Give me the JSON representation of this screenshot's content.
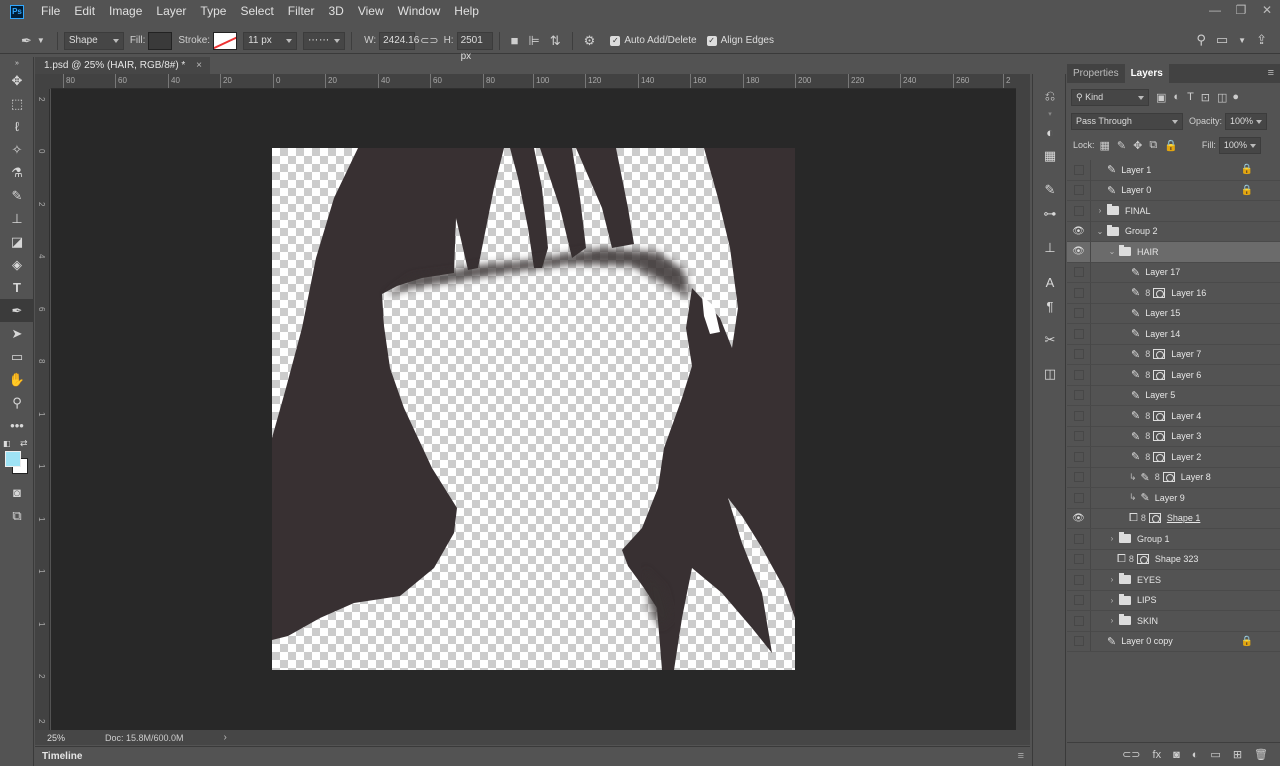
{
  "menu": {
    "logo": "Ps",
    "items": [
      "File",
      "Edit",
      "Image",
      "Layer",
      "Type",
      "Select",
      "Filter",
      "3D",
      "View",
      "Window",
      "Help"
    ],
    "window_controls": [
      "—",
      "❐",
      "✕"
    ]
  },
  "options": {
    "mode": "Shape",
    "fill_label": "Fill:",
    "stroke_label": "Stroke:",
    "stroke_width": "11 px",
    "w_label": "W:",
    "w_value": "2424.16",
    "h_label": "H:",
    "h_value": "2501 px",
    "auto_add_delete": "Auto Add/Delete",
    "align_edges": "Align Edges",
    "fill_color": "#3a3a3a"
  },
  "document": {
    "tab_title": "1.psd @ 25% (HAIR, RGB/8#) *",
    "zoom": "25%",
    "doc_info": "Doc: 15.8M/600.0M",
    "timeline": "Timeline"
  },
  "ruler": {
    "h_ticks": [
      "80",
      "60",
      "40",
      "20",
      "0",
      "20",
      "40",
      "60",
      "80",
      "100",
      "120",
      "140",
      "160",
      "180",
      "200",
      "220",
      "240",
      "260",
      "2"
    ],
    "v_ticks": [
      "2",
      "0",
      "2",
      "4",
      "6",
      "8",
      "1",
      "1",
      "1",
      "1",
      "1",
      "2",
      "2"
    ]
  },
  "panel": {
    "tab_properties": "Properties",
    "tab_layers": "Layers",
    "kind": "Kind",
    "blend_mode": "Pass Through",
    "opacity_label": "Opacity:",
    "opacity": "100%",
    "lock_label": "Lock:",
    "fill_label": "Fill:",
    "fill": "100%"
  },
  "layers": [
    {
      "name": "Layer 1",
      "visible": false,
      "indent": 0,
      "type": "brush",
      "locked": true
    },
    {
      "name": "Layer 0",
      "visible": false,
      "indent": 0,
      "type": "brush",
      "locked": true
    },
    {
      "name": "FINAL",
      "visible": false,
      "indent": 0,
      "type": "folder",
      "expanded": false
    },
    {
      "name": "Group 2",
      "visible": true,
      "indent": 0,
      "type": "folder",
      "expanded": true
    },
    {
      "name": "HAIR",
      "visible": true,
      "indent": 1,
      "type": "folder",
      "expanded": true,
      "selected": true
    },
    {
      "name": "Layer 17",
      "visible": false,
      "indent": 2,
      "type": "brush"
    },
    {
      "name": "Layer 16",
      "visible": false,
      "indent": 2,
      "type": "brush-mask"
    },
    {
      "name": "Layer 15",
      "visible": false,
      "indent": 2,
      "type": "brush"
    },
    {
      "name": "Layer 14",
      "visible": false,
      "indent": 2,
      "type": "brush"
    },
    {
      "name": "Layer 7",
      "visible": false,
      "indent": 2,
      "type": "brush-mask"
    },
    {
      "name": "Layer 6",
      "visible": false,
      "indent": 2,
      "type": "brush-mask"
    },
    {
      "name": "Layer 5",
      "visible": false,
      "indent": 2,
      "type": "brush"
    },
    {
      "name": "Layer 4",
      "visible": false,
      "indent": 2,
      "type": "brush-mask"
    },
    {
      "name": "Layer 3",
      "visible": false,
      "indent": 2,
      "type": "brush-mask"
    },
    {
      "name": "Layer 2",
      "visible": false,
      "indent": 2,
      "type": "brush-mask"
    },
    {
      "name": "Layer 8",
      "visible": false,
      "indent": 2,
      "type": "clip-brush-mask"
    },
    {
      "name": "Layer 9",
      "visible": false,
      "indent": 2,
      "type": "clip-brush"
    },
    {
      "name": "Shape 1",
      "visible": true,
      "indent": 2,
      "type": "shape",
      "underlined": true
    },
    {
      "name": "Group 1",
      "visible": false,
      "indent": 1,
      "type": "folder",
      "expanded": false
    },
    {
      "name": "Shape 323",
      "visible": false,
      "indent": 1,
      "type": "shape"
    },
    {
      "name": "EYES",
      "visible": false,
      "indent": 1,
      "type": "folder",
      "expanded": false
    },
    {
      "name": "LIPS",
      "visible": false,
      "indent": 1,
      "type": "folder",
      "expanded": false
    },
    {
      "name": "SKIN",
      "visible": false,
      "indent": 1,
      "type": "folder",
      "expanded": false
    },
    {
      "name": "Layer 0 copy",
      "visible": false,
      "indent": 0,
      "type": "brush",
      "locked": true
    }
  ]
}
